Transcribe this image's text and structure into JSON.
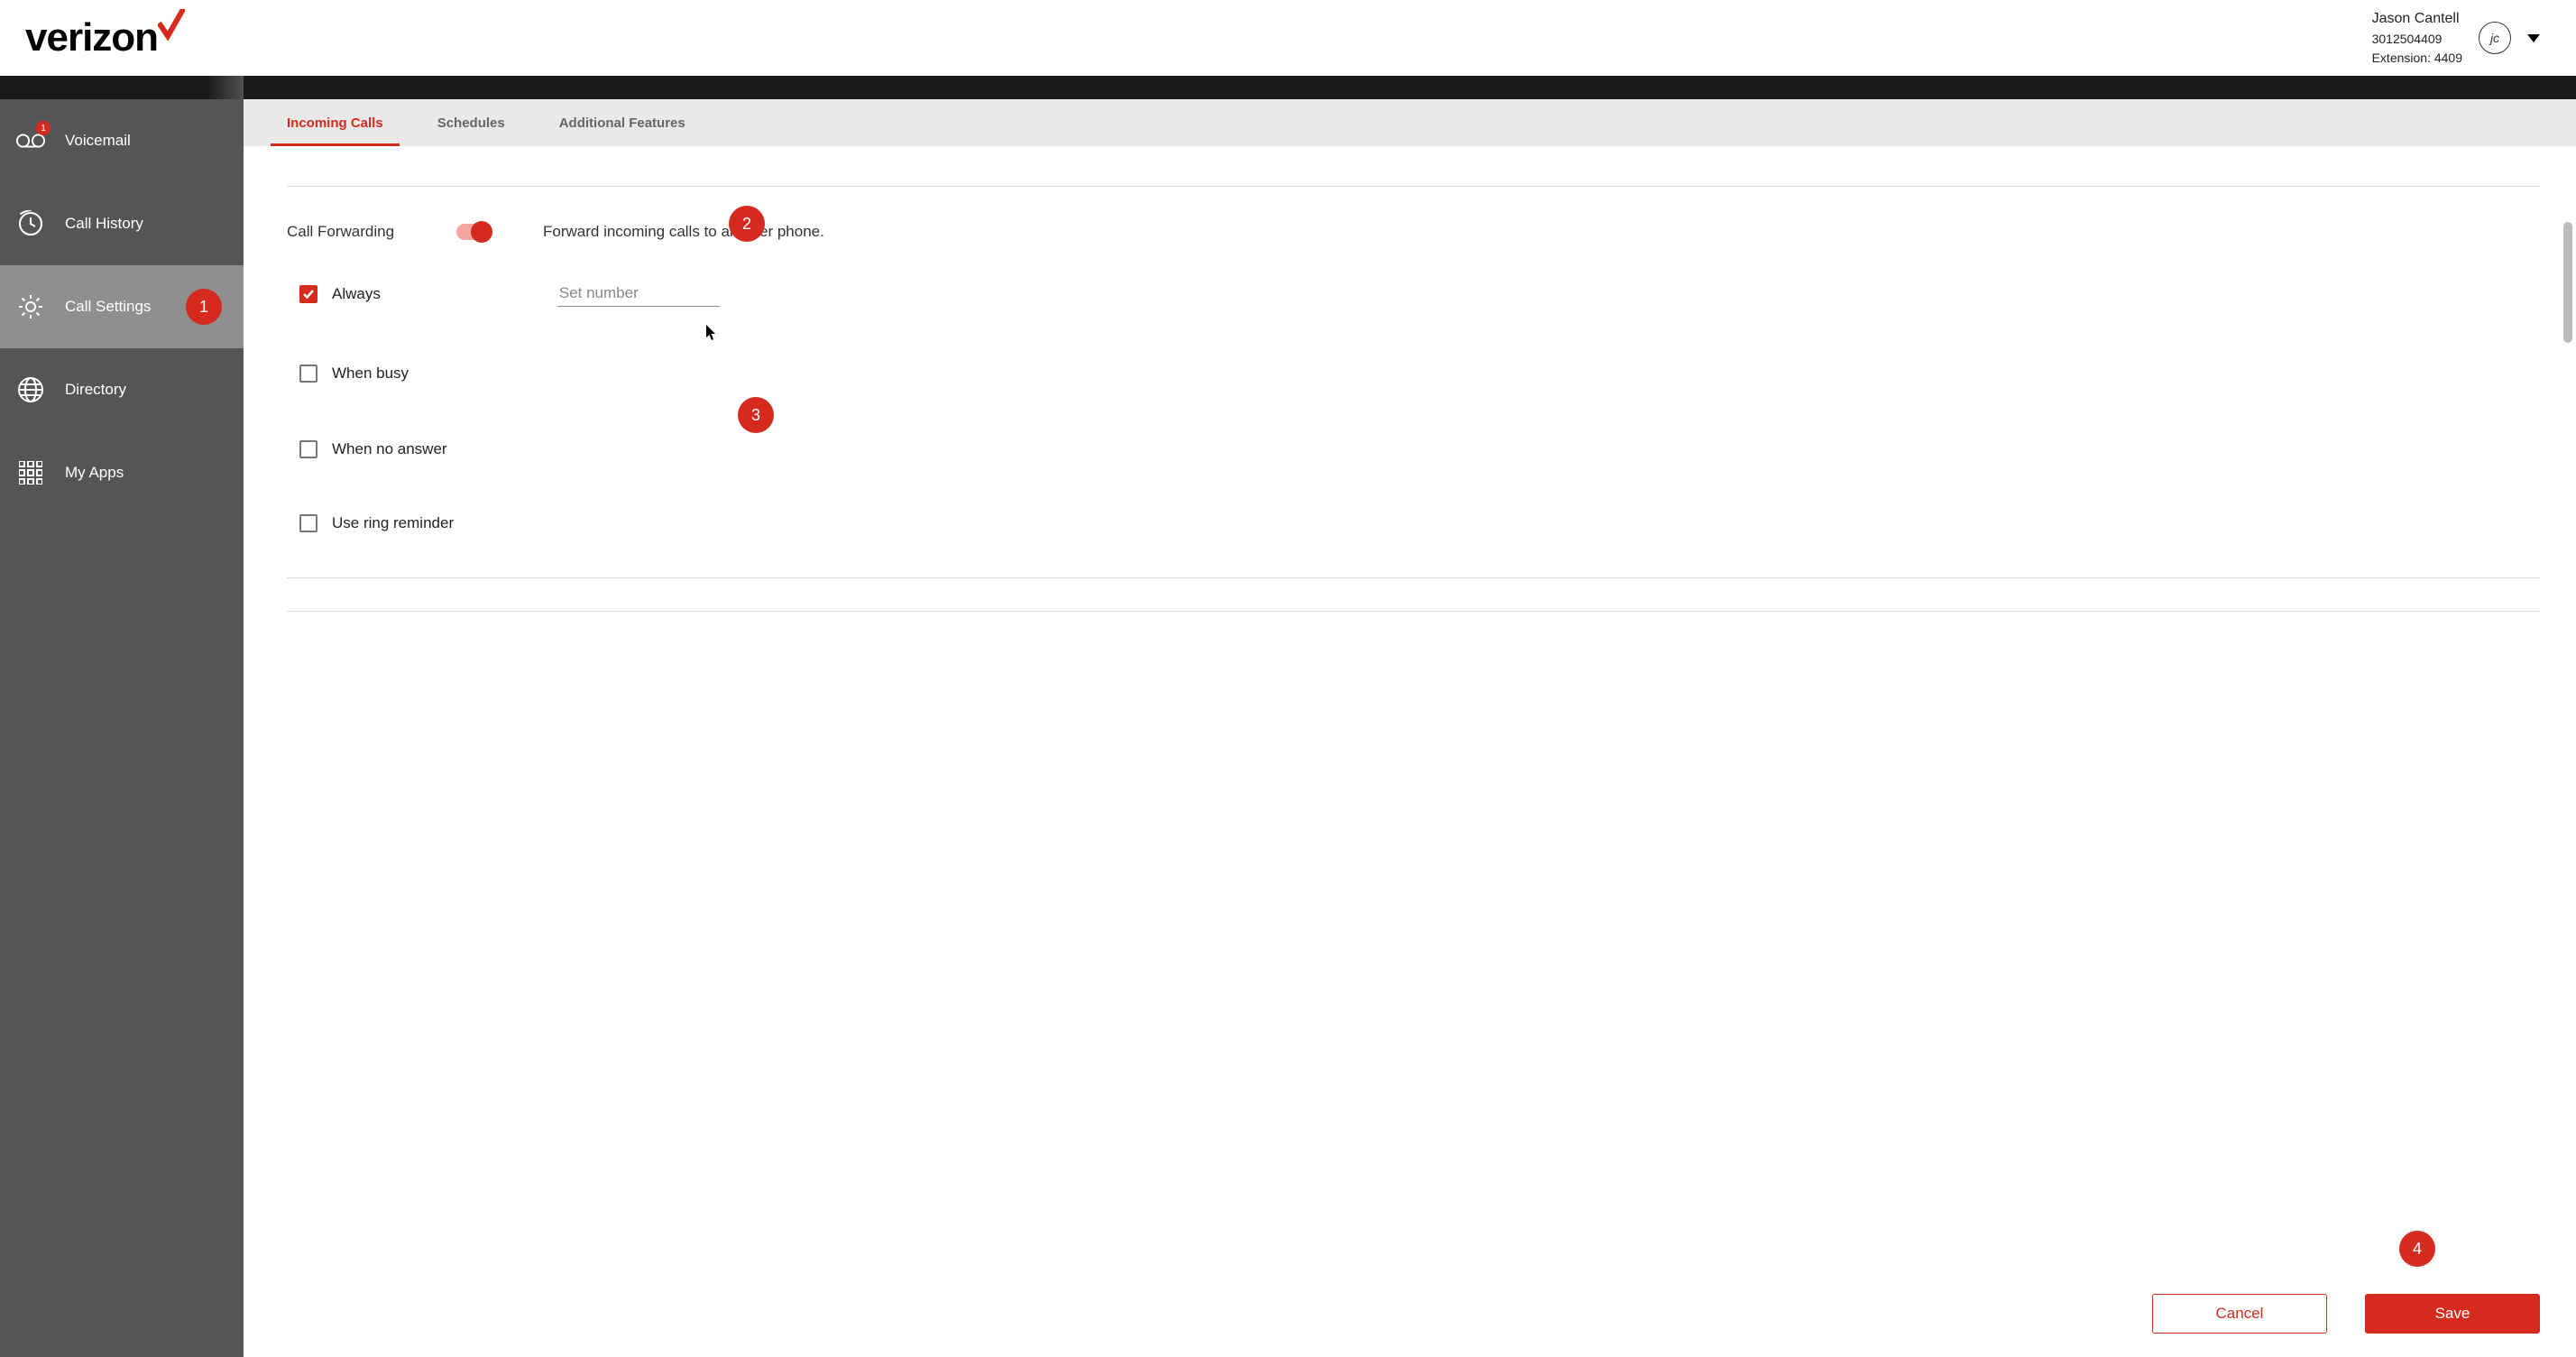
{
  "brand": {
    "name": "verizon"
  },
  "user": {
    "name": "Jason Cantell",
    "phone": "3012504409",
    "extension_label": "Extension: 4409",
    "initials": "jc"
  },
  "sidebar": {
    "items": [
      {
        "label": "Voicemail",
        "badge": "1"
      },
      {
        "label": "Call History"
      },
      {
        "label": "Call Settings"
      },
      {
        "label": "Directory"
      },
      {
        "label": "My Apps"
      }
    ]
  },
  "tabs": [
    {
      "label": "Incoming Calls",
      "active": true
    },
    {
      "label": "Schedules"
    },
    {
      "label": "Additional Features"
    }
  ],
  "call_forwarding": {
    "title": "Call Forwarding",
    "description": "Forward incoming calls to another phone.",
    "enabled": true,
    "number_placeholder": "Set number",
    "options": [
      {
        "label": "Always",
        "checked": true,
        "has_number": true
      },
      {
        "label": "When busy",
        "checked": false
      },
      {
        "label": "When no answer",
        "checked": false
      },
      {
        "label": "Use ring reminder",
        "checked": false
      }
    ]
  },
  "actions": {
    "cancel": "Cancel",
    "save": "Save"
  },
  "callouts": {
    "c1": "1",
    "c2": "2",
    "c3": "3",
    "c4": "4"
  },
  "colors": {
    "accent": "#d52b1e"
  }
}
